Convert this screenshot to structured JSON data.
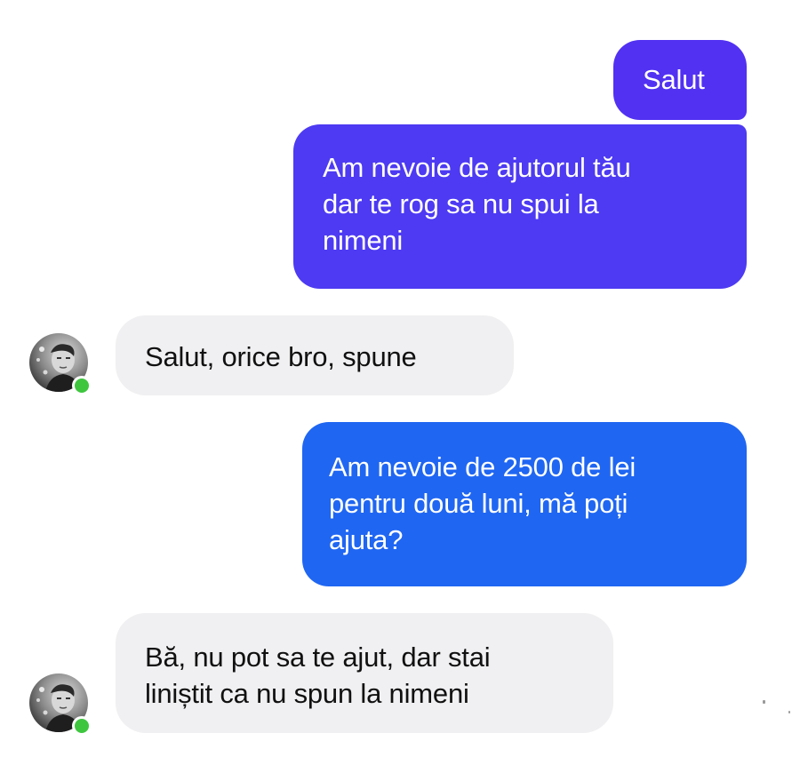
{
  "conversation": {
    "messages": [
      {
        "direction": "outgoing",
        "text": "Salut",
        "color": "#5231f2"
      },
      {
        "direction": "outgoing",
        "text": "Am nevoie de ajutorul tău\ndar te rog sa nu spui la\nnimeni",
        "color": "#4d3af2"
      },
      {
        "direction": "incoming",
        "text": "Salut, orice bro, spune",
        "color": "#f0f0f2"
      },
      {
        "direction": "outgoing",
        "text": "Am nevoie de 2500 de lei\npentru două luni, mă poți\najuta?",
        "color": "#1f66f2"
      },
      {
        "direction": "incoming",
        "text": "Bă, nu pot sa te ajut, dar stai\nliniștit ca nu spun la nimeni",
        "color": "#f0f0f2"
      }
    ]
  },
  "contact": {
    "avatar_icon": "user-avatar-photo",
    "presence": "online",
    "presence_color": "#3fc63f"
  }
}
